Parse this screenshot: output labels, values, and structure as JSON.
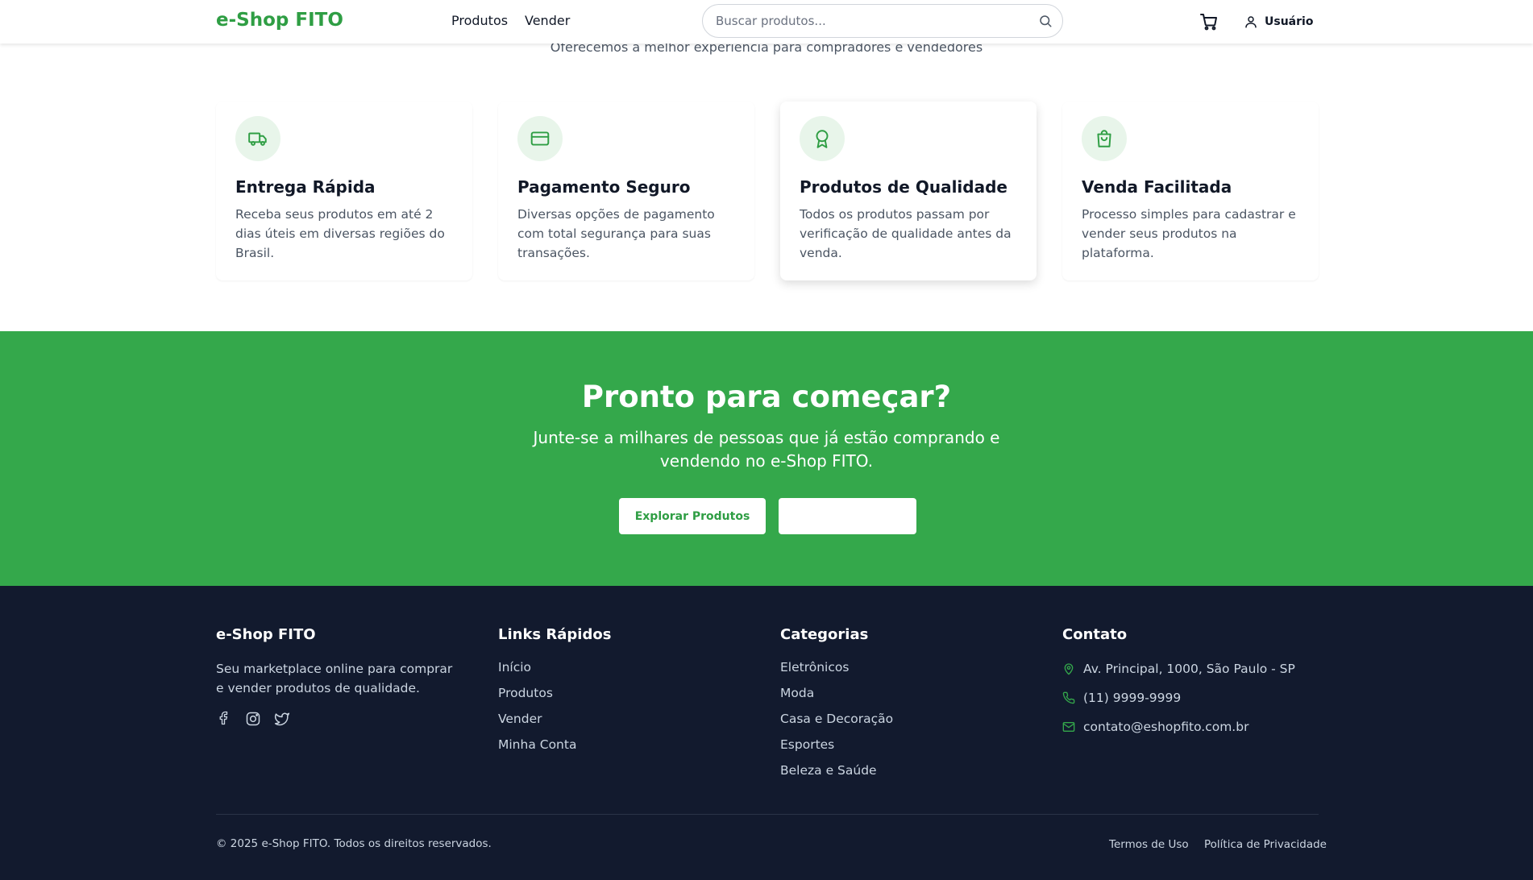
{
  "header": {
    "logo": "e-Shop FITO",
    "nav": {
      "products": "Produtos",
      "sell": "Vender"
    },
    "search_placeholder": "Buscar produtos...",
    "user_label": "Usuário"
  },
  "intro": {
    "subtitle": "Oferecemos a melhor experiência para compradores e vendedores"
  },
  "features": [
    {
      "icon": "truck-icon",
      "title": "Entrega Rápida",
      "desc": "Receba seus produtos em até 2 dias úteis em diversas regiões do Brasil."
    },
    {
      "icon": "credit-card-icon",
      "title": "Pagamento Seguro",
      "desc": "Diversas opções de pagamento com total segurança para suas transações."
    },
    {
      "icon": "award-icon",
      "title": "Produtos de Qualidade",
      "desc": "Todos os produtos passam por verificação de qualidade antes da venda."
    },
    {
      "icon": "shopping-bag-icon",
      "title": "Venda Facilitada",
      "desc": "Processo simples para cadastrar e vender seus produtos na plataforma."
    }
  ],
  "cta": {
    "title": "Pronto para começar?",
    "text": "Junte-se a milhares de pessoas que já estão comprando e vendendo no e-Shop FITO.",
    "primary_button": "Explorar Produtos",
    "secondary_button": ""
  },
  "footer": {
    "brand": {
      "title": "e-Shop FITO",
      "text": "Seu marketplace online para comprar e vender produtos de qualidade."
    },
    "quick_links": {
      "title": "Links Rápidos",
      "items": [
        "Início",
        "Produtos",
        "Vender",
        "Minha Conta"
      ]
    },
    "categories": {
      "title": "Categorias",
      "items": [
        "Eletrônicos",
        "Moda",
        "Casa e Decoração",
        "Esportes",
        "Beleza e Saúde"
      ]
    },
    "contact": {
      "title": "Contato",
      "address": "Av. Principal, 1000, São Paulo - SP",
      "phone": "(11) 9999-9999",
      "email": "contato@eshopfito.com.br"
    },
    "copyright": "© 2025 e-Shop FITO. Todos os direitos reservados.",
    "terms": "Termos de Uso",
    "privacy": "Política de Privacidade"
  },
  "colors": {
    "brand_green": "#2f9e44",
    "cta_green": "#34a84b",
    "footer_bg": "#121a2e",
    "icon_circle": "#e8f5ea"
  }
}
